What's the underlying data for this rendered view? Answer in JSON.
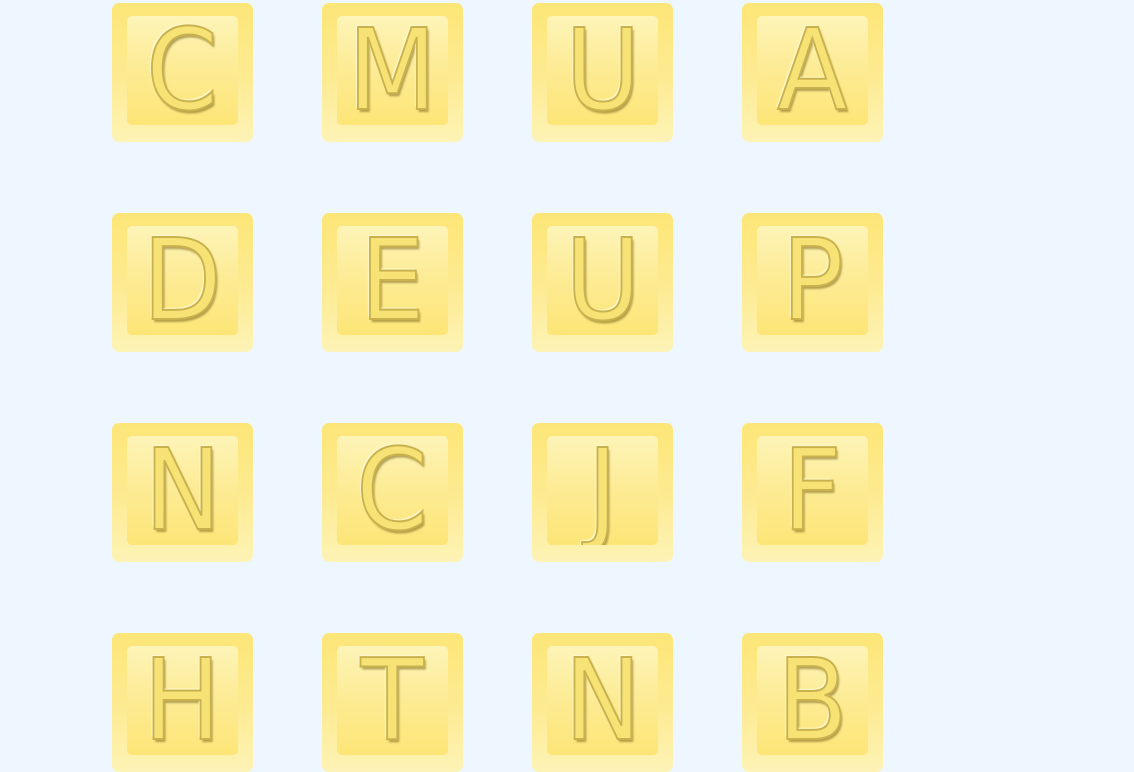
{
  "board": {
    "tiles": [
      {
        "letter": "C"
      },
      {
        "letter": "M"
      },
      {
        "letter": "U"
      },
      {
        "letter": "A"
      },
      {
        "letter": "D"
      },
      {
        "letter": "E"
      },
      {
        "letter": "U"
      },
      {
        "letter": "P"
      },
      {
        "letter": "N"
      },
      {
        "letter": "C"
      },
      {
        "letter": "J"
      },
      {
        "letter": "F"
      },
      {
        "letter": "H"
      },
      {
        "letter": "T"
      },
      {
        "letter": "N"
      },
      {
        "letter": "B"
      }
    ]
  },
  "colors": {
    "background": "#eef7ff",
    "tile_outer": "#fde677",
    "tile_inner": "#fdf4b8",
    "letter_stroke": "#c9b24e"
  }
}
